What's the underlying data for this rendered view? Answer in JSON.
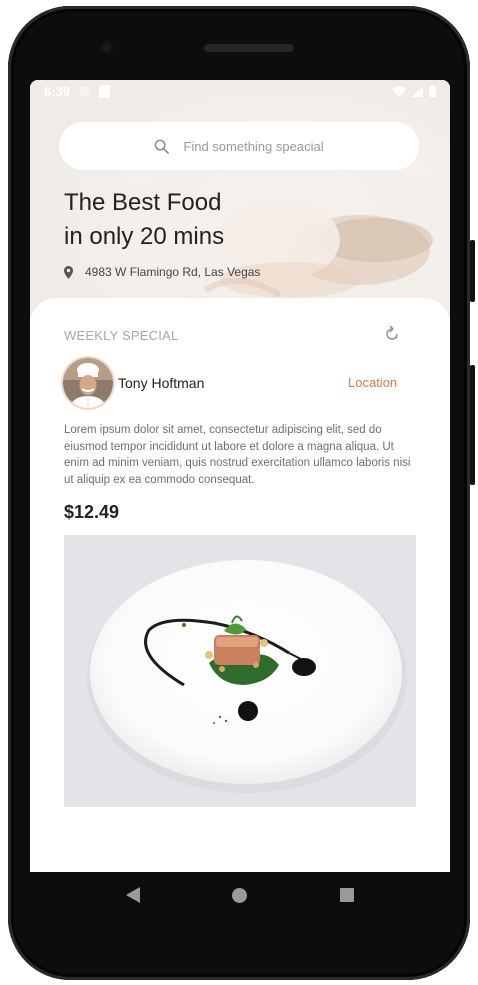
{
  "status_bar": {
    "time": "6:39",
    "left_icons": [
      "gear-icon",
      "sd-card-icon"
    ],
    "right_icons": [
      "wifi-icon",
      "signal-icon",
      "battery-icon"
    ]
  },
  "search": {
    "placeholder": "Find something speacial"
  },
  "hero": {
    "title_line1": "The Best Food",
    "title_line2": "in only 20 mins",
    "address": "4983 W Flamingo Rd, Las Vegas"
  },
  "special": {
    "section_label": "WEEKLY SPECIAL",
    "chef_name": "Tony Hoftman",
    "location_label": "Location",
    "description": "Lorem ipsum dolor sit amet, consectetur adipiscing elit, sed do eiusmod tempor incididunt ut labore et dolore a magna aliqua. Ut enim ad minim veniam, quis nostrud exercitation ullamco laboris nisi ut aliquip ex ea commodo consequat.",
    "price": "$12.49"
  },
  "nav": {
    "buttons": [
      "back-icon",
      "home-icon",
      "recents-icon"
    ]
  },
  "colors": {
    "accent": "#e07b4e",
    "muted_label": "#a7a7a7",
    "body_text": "#6f6f6f",
    "frame": "#0d0d0d"
  }
}
